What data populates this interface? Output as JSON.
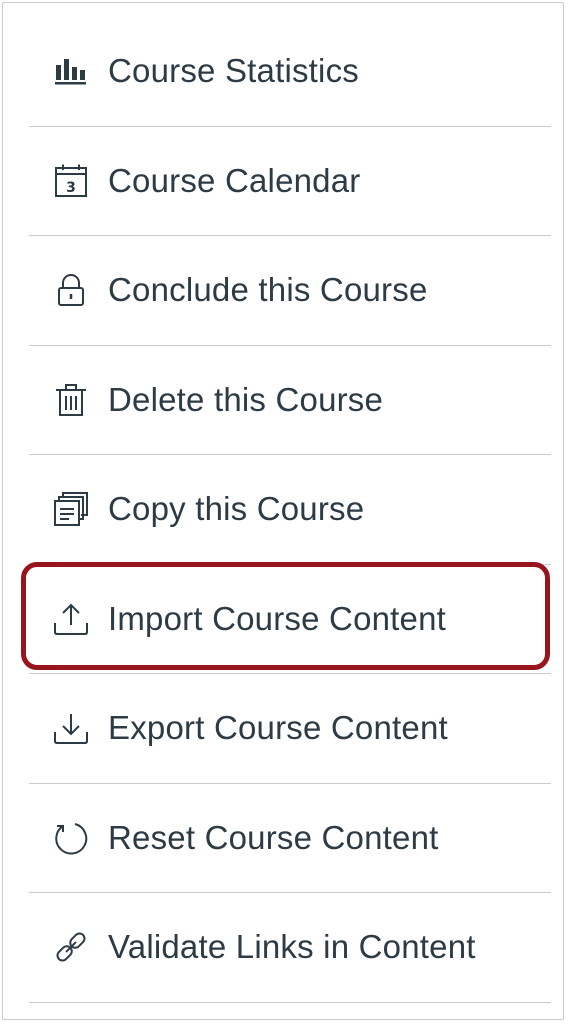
{
  "menu": {
    "items": [
      {
        "label": "Course Statistics",
        "icon": "bar-chart-icon"
      },
      {
        "label": "Course Calendar",
        "icon": "calendar-icon"
      },
      {
        "label": "Conclude this Course",
        "icon": "lock-icon"
      },
      {
        "label": "Delete this Course",
        "icon": "trash-icon"
      },
      {
        "label": "Copy this Course",
        "icon": "copy-icon"
      },
      {
        "label": "Import Course Content",
        "icon": "upload-icon"
      },
      {
        "label": "Export Course Content",
        "icon": "download-icon"
      },
      {
        "label": "Reset Course Content",
        "icon": "reset-icon"
      },
      {
        "label": "Validate Links in Content",
        "icon": "link-icon"
      }
    ]
  },
  "calendar_icon_day": "3",
  "colors": {
    "text": "#2d3b45",
    "divider": "#c7cdd1",
    "highlight_border": "#99151d"
  },
  "highlighted_item": "Import Course Content"
}
